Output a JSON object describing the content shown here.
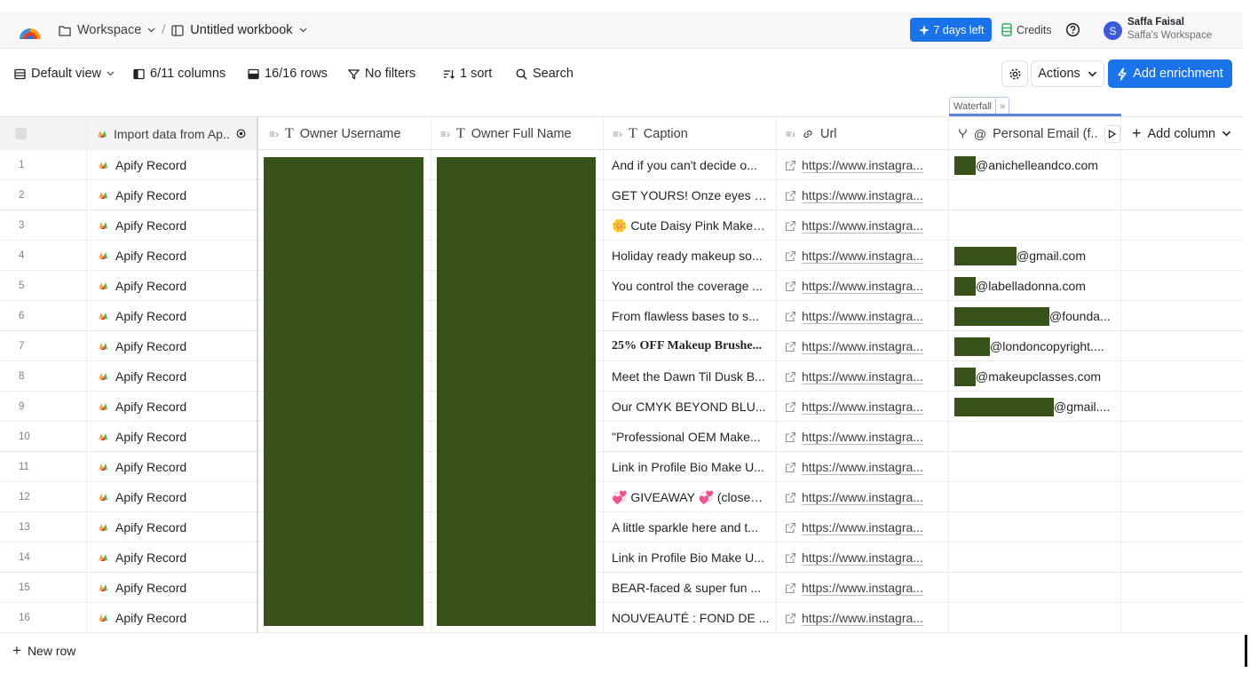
{
  "topbar": {
    "workspace": "Workspace",
    "workbook": "Untitled workbook",
    "trial_badge": "7 days left",
    "credits": "Credits",
    "user_initial": "S",
    "user_name": "Saffa Faisal",
    "user_workspace": "Saffa's Workspace"
  },
  "toolbar": {
    "view": "Default view",
    "columns": "6/11 columns",
    "rows": "16/16 rows",
    "filters": "No filters",
    "sort": "1 sort",
    "search": "Search",
    "actions": "Actions",
    "add_enrichment": "Add enrichment",
    "waterfall": "Waterfall"
  },
  "columns": {
    "source": "Import data from Ap..",
    "owner_username": "Owner Username",
    "owner_full_name": "Owner Full Name",
    "caption": "Caption",
    "url": "Url",
    "personal_email": "Personal Email (f..",
    "add_column": "Add column"
  },
  "colors": {
    "accent": "#1a73e8",
    "redaction": "#375219"
  },
  "rows": [
    {
      "num": "1",
      "source": "Apify Record",
      "caption": "And if you can't decide o...",
      "url": "https://www.instagra...",
      "email_suffix": "@anichelleandco.com",
      "redact_w": 24
    },
    {
      "num": "2",
      "source": "Apify Record",
      "caption": "GET YOURS! Onze eyes s...",
      "url": "https://www.instagra...",
      "email_suffix": "",
      "redact_w": 0
    },
    {
      "num": "3",
      "source": "Apify Record",
      "caption": "🌼 Cute Daisy Pink Makeu...",
      "url": "https://www.instagra...",
      "email_suffix": "",
      "redact_w": 0
    },
    {
      "num": "4",
      "source": "Apify Record",
      "caption": "Holiday ready makeup so...",
      "url": "https://www.instagra...",
      "email_suffix": "@gmail.com",
      "redact_w": 70
    },
    {
      "num": "5",
      "source": "Apify Record",
      "caption": "You control the coverage ...",
      "url": "https://www.instagra...",
      "email_suffix": "@labelladonna.com",
      "redact_w": 24
    },
    {
      "num": "6",
      "source": "Apify Record",
      "caption": "From flawless bases to s...",
      "url": "https://www.instagra...",
      "email_suffix": "@founda...",
      "redact_w": 107
    },
    {
      "num": "7",
      "source": "Apify Record",
      "caption": "25% OFF Makeup Brushe...",
      "url": "https://www.instagra...",
      "email_suffix": "@londoncopyright....",
      "redact_w": 40
    },
    {
      "num": "8",
      "source": "Apify Record",
      "caption": "Meet the Dawn Til Dusk B...",
      "url": "https://www.instagra...",
      "email_suffix": "@makeupclasses.com",
      "redact_w": 24
    },
    {
      "num": "9",
      "source": "Apify Record",
      "caption": "Our CMYK BEYOND BLU...",
      "url": "https://www.instagra...",
      "email_suffix": "@gmail....",
      "redact_w": 112
    },
    {
      "num": "10",
      "source": "Apify Record",
      "caption": "\"Professional OEM Make...",
      "url": "https://www.instagra...",
      "email_suffix": "",
      "redact_w": 0
    },
    {
      "num": "11",
      "source": "Apify Record",
      "caption": "Link in Profile Bio Make U...",
      "url": "https://www.instagra...",
      "email_suffix": "",
      "redact_w": 0
    },
    {
      "num": "12",
      "source": "Apify Record",
      "caption": "💞 GIVEAWAY 💞 (closed) ...",
      "url": "https://www.instagra...",
      "email_suffix": "",
      "redact_w": 0
    },
    {
      "num": "13",
      "source": "Apify Record",
      "caption": "A little sparkle here and t...",
      "url": "https://www.instagra...",
      "email_suffix": "",
      "redact_w": 0
    },
    {
      "num": "14",
      "source": "Apify Record",
      "caption": "Link in Profile Bio Make U...",
      "url": "https://www.instagra...",
      "email_suffix": "",
      "redact_w": 0
    },
    {
      "num": "15",
      "source": "Apify Record",
      "caption": "BEAR-faced & super fun ...",
      "url": "https://www.instagra...",
      "email_suffix": "",
      "redact_w": 0
    },
    {
      "num": "16",
      "source": "Apify Record",
      "caption": "NOUVEAUTÉ : FOND DE ...",
      "url": "https://www.instagra...",
      "email_suffix": "",
      "redact_w": 0
    }
  ],
  "footer": {
    "new_row": "New row"
  }
}
